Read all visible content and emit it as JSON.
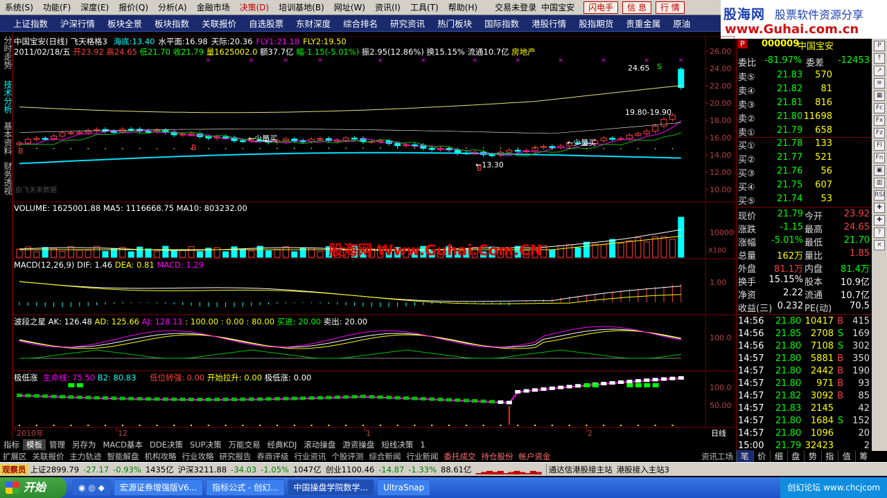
{
  "menu": {
    "items": [
      "系统(S)",
      "功能(F)",
      "深度(E)",
      "报价(Q)",
      "分析(A)",
      "金融市场",
      "决策(D)",
      "培训基地(B)",
      "网址(W)",
      "资讯(I)",
      "工具(T)",
      "帮助(H)"
    ],
    "status": "交易未登录",
    "stock_name": "中国宝安",
    "buttons": [
      "闪电手",
      "信 息",
      "行 情"
    ]
  },
  "brand": {
    "name": "股海网",
    "slogan": "股票软件资源分享",
    "url": "www.Guhai.com.cn"
  },
  "nav": [
    "上证指数",
    "沪深行情",
    "板块全景",
    "板块指数",
    "关联报价",
    "自选股票",
    "东财深度",
    "综合排名",
    "研究资讯",
    "热门板块",
    "国际指数",
    "港股行情",
    "股指期货",
    "贵重金属",
    "原油"
  ],
  "left_tabs": [
    {
      "label": "分时走势",
      "active": false
    },
    {
      "label": "技术分析",
      "active": true
    },
    {
      "label": "基本资料",
      "active": false
    },
    {
      "label": "财务透视",
      "active": false
    }
  ],
  "main_panel": {
    "title": "中国宝安(日线) 飞天格格3",
    "indicators": [
      {
        "label": "海底:",
        "value": "13.40",
        "color": "#00ffff"
      },
      {
        "label": "水平面:",
        "value": "16.98",
        "color": "#ffffff"
      },
      {
        "label": "天际:",
        "value": "20.36",
        "color": "#ffffff"
      },
      {
        "label": "FLY1:",
        "value": "21.18",
        "color": "#ff00ff"
      },
      {
        "label": "FLY2:",
        "value": "19.50",
        "color": "#ffff00"
      }
    ],
    "date": "2011/02/18/五",
    "ohlc": {
      "open": "开23.92",
      "high": "高24.65",
      "low": "低21.70",
      "close": "收21.79",
      "vol": "量1625002.0",
      "amt": "额37.7亿",
      "chg": "幅-1.15(-5.01%)",
      "amp": "振2.95(12.86%)",
      "turnover": "换15.15%",
      "float": "流通10.7亿",
      "sector": "房地产"
    },
    "annotations": {
      "hi": "24.65",
      "lo": "←13.30",
      "range": "19.80-19.90",
      "buy1": "←少量买",
      "buy2": "←少量买",
      "b_mark": "B",
      "s_mark": "S",
      "watermark": "由飞天来数据"
    },
    "y_ticks": [
      "26.00",
      "24.00",
      "22.00",
      "20.00",
      "18.00",
      "16.00",
      "14.00",
      "12.00",
      "10.00"
    ]
  },
  "volume_panel": {
    "label": "VOLUME: 1625001.88",
    "ma5": "MA5: 1116668.75",
    "ma10": "MA10: 803232.00",
    "y_tick": "10000",
    "unit": "X100",
    "watermark": "股海网 Www.Guhai.Com.CN"
  },
  "macd_panel": {
    "label": "MACD(12,26,9)",
    "dif": "DIF: 1.46",
    "dea": "DEA: 0.81",
    "macd": "MACD: 1.29",
    "y_tick": "1.00"
  },
  "wave_panel": {
    "label": "波段之星",
    "ak": "AK: 126.48",
    "ad": "AD: 125.66",
    "aj": "AJ: 128.11",
    "rest": ": 100.00 : 0.00 : 80.00",
    "buy": "买进: 20.00",
    "sell": "卖出: 20.00",
    "y_tick": "100.0"
  },
  "low_panel": {
    "label": "极低涨",
    "life": "生命线: 75.50",
    "b2": "B2: 80.83",
    "strong": "低位转强: 0.00",
    "pull": "开始拉升: 0.00",
    "low": "极低涨: 0.00",
    "y_ticks": [
      "100.0",
      "50.00"
    ]
  },
  "x_axis": {
    "labels": [
      "2010年",
      "12",
      "1",
      "2"
    ],
    "period": "日线"
  },
  "quote": {
    "code": "000009",
    "name": "中国宝安",
    "wb": {
      "label": "委比",
      "value": "-81.97%"
    },
    "wc": {
      "label": "委差",
      "value": "-12453"
    },
    "asks": [
      {
        "label": "卖⑤",
        "price": "21.83",
        "vol": "570"
      },
      {
        "label": "卖④",
        "price": "21.82",
        "vol": "81"
      },
      {
        "label": "卖③",
        "price": "21.81",
        "vol": "816"
      },
      {
        "label": "卖②",
        "price": "21.80",
        "vol": "11698"
      },
      {
        "label": "卖①",
        "price": "21.79",
        "vol": "658"
      }
    ],
    "bids": [
      {
        "label": "买①",
        "price": "21.78",
        "vol": "133"
      },
      {
        "label": "买②",
        "price": "21.77",
        "vol": "521"
      },
      {
        "label": "买③",
        "price": "21.76",
        "vol": "56"
      },
      {
        "label": "买④",
        "price": "21.75",
        "vol": "607"
      },
      {
        "label": "买⑤",
        "price": "21.74",
        "vol": "53"
      }
    ],
    "stats": [
      {
        "l1": "现价",
        "v1": "21.79",
        "c1": "#00ff00",
        "l2": "今开",
        "v2": "23.92",
        "c2": "#ff4040"
      },
      {
        "l1": "涨跌",
        "v1": "-1.15",
        "c1": "#00ff00",
        "l2": "最高",
        "v2": "24.65",
        "c2": "#ff4040"
      },
      {
        "l1": "涨幅",
        "v1": "-5.01%",
        "c1": "#00ff00",
        "l2": "最低",
        "v2": "21.70",
        "c2": "#00ff00"
      },
      {
        "l1": "总量",
        "v1": "162万",
        "c1": "#ffff00",
        "l2": "量比",
        "v2": "1.85",
        "c2": "#ff4040"
      },
      {
        "l1": "外盘",
        "v1": "81.1万",
        "c1": "#ff4040",
        "l2": "内盘",
        "v2": "81.4万",
        "c2": "#00ff00"
      },
      {
        "l1": "换手",
        "v1": "15.15%",
        "c1": "#ffffff",
        "l2": "股本",
        "v2": "10.9亿",
        "c2": "#ffffff"
      },
      {
        "l1": "净资",
        "v1": "2.22",
        "c1": "#ffffff",
        "l2": "流通",
        "v2": "10.7亿",
        "c2": "#ffffff"
      },
      {
        "l1": "收益(三)",
        "v1": "0.232",
        "c1": "#ffffff",
        "l2": "PE(动)",
        "v2": "70.5",
        "c2": "#ffffff"
      }
    ],
    "ticks": [
      {
        "t": "14:56",
        "p": "21.80",
        "v": "10417",
        "side": "B",
        "n": "415"
      },
      {
        "t": "14:56",
        "p": "21.85",
        "v": "2708",
        "side": "S",
        "n": "169"
      },
      {
        "t": "14:56",
        "p": "21.80",
        "v": "7108",
        "side": "S",
        "n": "302"
      },
      {
        "t": "14:57",
        "p": "21.80",
        "v": "5881",
        "side": "B",
        "n": "350"
      },
      {
        "t": "14:57",
        "p": "21.80",
        "v": "2442",
        "side": "B",
        "n": "190"
      },
      {
        "t": "14:57",
        "p": "21.80",
        "v": "971",
        "side": "B",
        "n": "93"
      },
      {
        "t": "14:57",
        "p": "21.82",
        "v": "3092",
        "side": "B",
        "n": "85"
      },
      {
        "t": "14:57",
        "p": "21.83",
        "v": "2145",
        "side": "",
        "n": "42"
      },
      {
        "t": "14:57",
        "p": "21.80",
        "v": "1684",
        "side": "S",
        "n": "152"
      },
      {
        "t": "14:57",
        "p": "21.80",
        "v": "1096",
        "side": "",
        "n": "20"
      },
      {
        "t": "15:00",
        "p": "21.79",
        "v": "32423",
        "side": "",
        "n": "2"
      }
    ]
  },
  "right_strip_icons": [
    "P",
    "↑",
    "↗",
    "≡",
    "▦",
    "Fc",
    "Fx",
    "Fz",
    "Fl",
    "Fn",
    "▣",
    "▥",
    "RSI",
    "✚",
    "✚",
    "?",
    "×"
  ],
  "bottom_tabs": [
    {
      "label": "指标",
      "active": false
    },
    {
      "label": "模板",
      "active": true
    },
    {
      "label": "管理",
      "active": false
    },
    {
      "label": "另存为",
      "active": false
    },
    {
      "label": "MACD基本",
      "active": false
    },
    {
      "label": "DDE决策",
      "active": false
    },
    {
      "label": "SUP决策",
      "active": false
    },
    {
      "label": "万能交易",
      "active": false
    },
    {
      "label": "经典KDJ",
      "active": false
    },
    {
      "label": "滚动操盘",
      "active": false
    },
    {
      "label": "游资操盘",
      "active": false
    },
    {
      "label": "短线决策",
      "active": false
    },
    {
      "label": "1",
      "active": false
    }
  ],
  "func_bar": [
    "扩展区",
    "关联报价",
    "主力轨迹",
    "智能解盘",
    "机构攻略",
    "行业攻略",
    "研究报告",
    "券商评级",
    "行业资讯",
    "个股评测",
    "综合新闻",
    "行业新闻",
    "委托成交",
    "持仓股份",
    "帐户资金"
  ],
  "func_right": "资讯工场",
  "right_bottom_tabs": [
    "笔",
    "价",
    "细",
    "盘",
    "势",
    "指",
    "值",
    "筹"
  ],
  "index_bar": {
    "badge": "观察员",
    "sh": "上证2899.79",
    "sh_chg": "-27.17",
    "sh_pct": "-0.93%",
    "sh_amt": "1435亿",
    "hs": "沪深3211.88",
    "hs_chg": "-34.03",
    "hs_pct": "-1.05%",
    "hs_amt": "1047亿",
    "cy": "创业1100.46",
    "cy_chg": "-14.87",
    "cy_pct": "-1.33%",
    "cy_amt": "88.61亿",
    "link1": "通达信港股接主站",
    "link2": "港股接入主站3"
  },
  "taskbar": {
    "start": "开始",
    "tasks": [
      "宏源证券增强版V6...",
      "指标公式 - 创幻...",
      "中国操盘学院数学...",
      "UltraSnap"
    ],
    "tray": "创幻论坛 www.chcjcom"
  }
}
